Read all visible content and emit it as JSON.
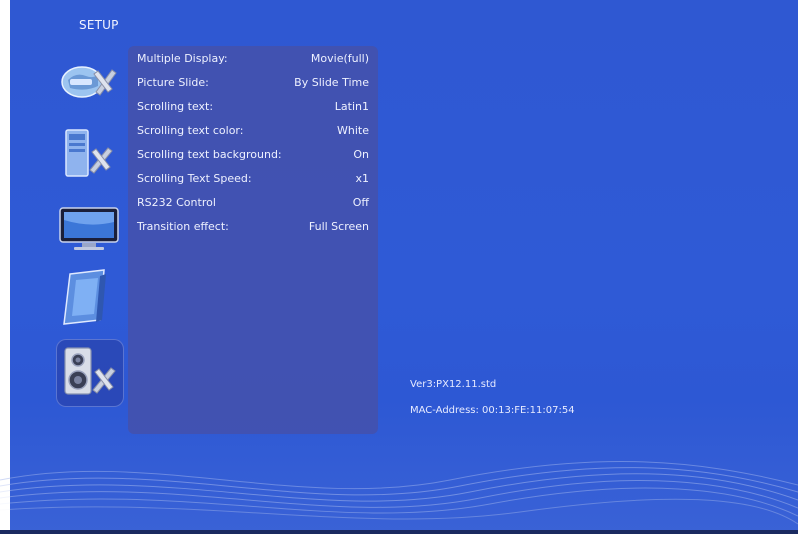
{
  "screen": {
    "title": "SETUP"
  },
  "sidebar": {
    "icons": [
      {
        "name": "general-settings-icon"
      },
      {
        "name": "device-settings-icon"
      },
      {
        "name": "display-settings-icon"
      },
      {
        "name": "file-settings-icon"
      },
      {
        "name": "audio-settings-icon",
        "selected": true
      }
    ]
  },
  "menu": {
    "items": [
      {
        "label": "Multiple Display:",
        "value": "Movie(full)"
      },
      {
        "label": "Picture Slide:",
        "value": "By Slide Time"
      },
      {
        "label": "Scrolling text:",
        "value": "Latin1"
      },
      {
        "label": "Scrolling text color:",
        "value": "White"
      },
      {
        "label": "Scrolling text background:",
        "value": "On"
      },
      {
        "label": "Scrolling Text Speed:",
        "value": "x1"
      },
      {
        "label": "RS232 Control",
        "value": "Off"
      },
      {
        "label": "Transition effect:",
        "value": "Full Screen"
      }
    ]
  },
  "info": {
    "version": "Ver3:PX12.11.std",
    "mac": "MAC-Address: 00:13:FE:11:07:54"
  },
  "colors": {
    "background": "#2f58d2",
    "panel": "#4650aa",
    "text": "#ffffff"
  }
}
